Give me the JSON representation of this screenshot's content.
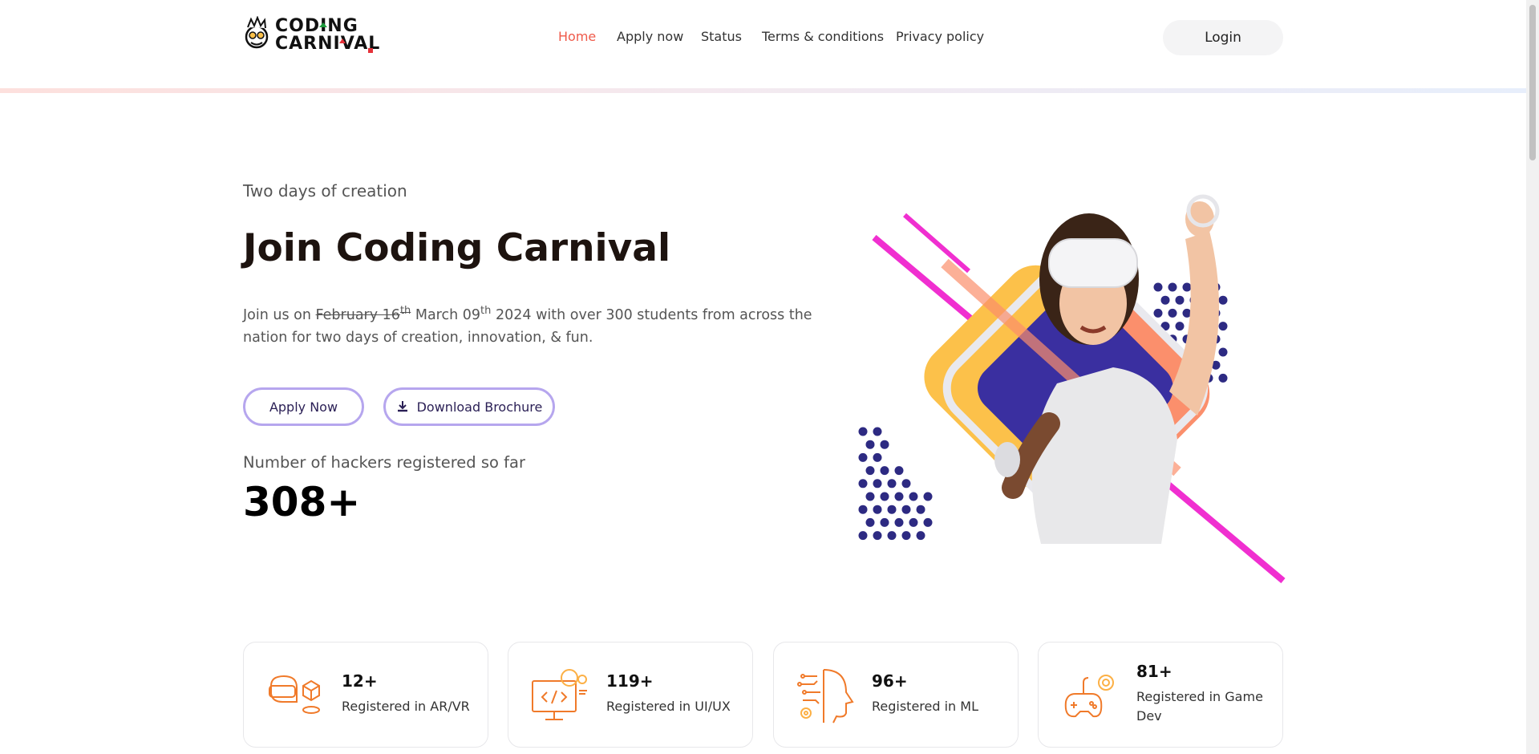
{
  "brand": {
    "logo_line1": "CODING",
    "logo_line2": "CARNIVAL"
  },
  "nav": {
    "items": [
      {
        "label": "Home",
        "active": true
      },
      {
        "label": "Apply now",
        "active": false
      },
      {
        "label": "Status",
        "active": false
      },
      {
        "label": "Terms & conditions",
        "active": false
      },
      {
        "label": "Privacy policy",
        "active": false
      }
    ],
    "login_label": "Login"
  },
  "hero": {
    "tagline": "Two days of creation",
    "title": "Join Coding Carnival",
    "desc_prefix": "Join us on",
    "old_date": "February 16",
    "old_date_suffix": "th",
    "new_date": "March 09",
    "new_date_suffix": "th",
    "desc_suffix": "2024 with over 300 students from across the nation for two days of creation, innovation, & fun.",
    "apply_label": "Apply Now",
    "brochure_label": "Download Brochure",
    "count_label": "Number of hackers registered so far",
    "count_value": "308+"
  },
  "stats": [
    {
      "value": "12+",
      "label": "Registered in AR/VR",
      "icon": "vr-headset-icon"
    },
    {
      "value": "119+",
      "label": "Registered in UI/UX",
      "icon": "code-monitor-icon"
    },
    {
      "value": "96+",
      "label": "Registered in ML",
      "icon": "ai-head-icon"
    },
    {
      "value": "81+",
      "label": "Registered in Game Dev",
      "icon": "gamepad-icon"
    }
  ],
  "colors": {
    "accent": "#ef5a4a",
    "button_border": "#b6a6ee",
    "icon_orange": "#f07a2a",
    "art_navy": "#2d2a82",
    "art_magenta": "#f02fd0",
    "art_peach": "#fb8f6c",
    "art_yellow": "#fcc14a"
  }
}
